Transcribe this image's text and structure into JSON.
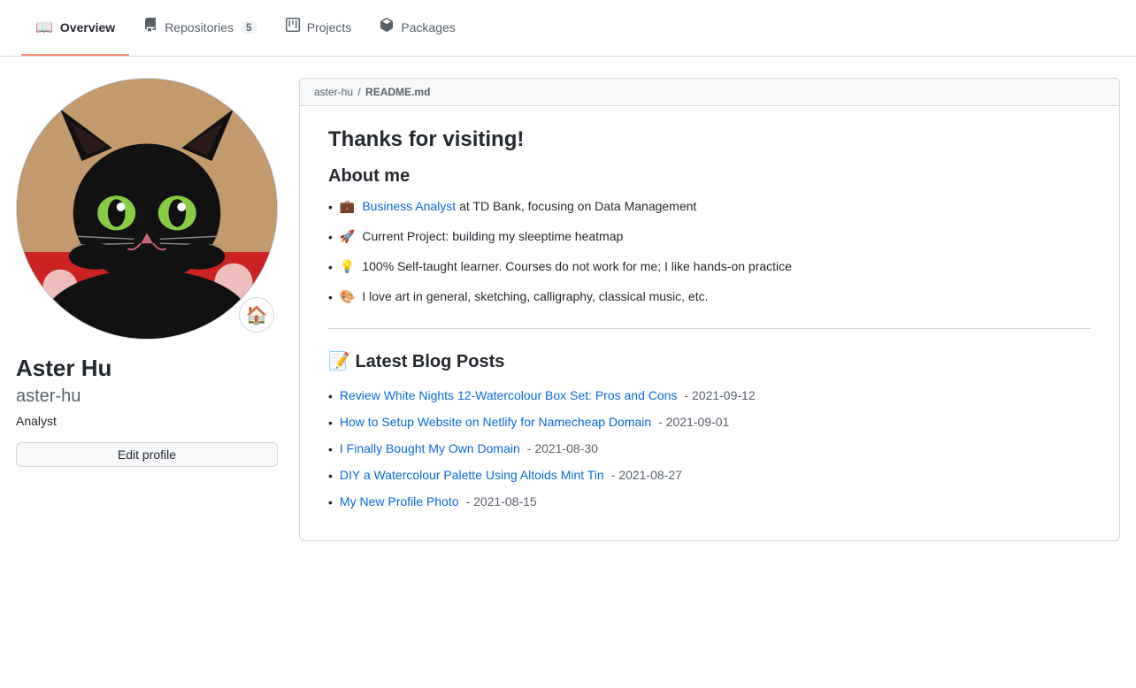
{
  "nav": {
    "tabs": [
      {
        "id": "overview",
        "label": "Overview",
        "icon": "📖",
        "active": true,
        "badge": null
      },
      {
        "id": "repositories",
        "label": "Repositories",
        "icon": "📂",
        "active": false,
        "badge": "5"
      },
      {
        "id": "projects",
        "label": "Projects",
        "icon": "📋",
        "active": false,
        "badge": null
      },
      {
        "id": "packages",
        "label": "Packages",
        "icon": "📦",
        "active": false,
        "badge": null
      }
    ]
  },
  "profile": {
    "display_name": "Aster Hu",
    "username": "aster-hu",
    "bio": "Analyst",
    "edit_button_label": "Edit profile",
    "avatar_badge_emoji": "🏠",
    "readme_path_user": "aster-hu",
    "readme_path_separator": "/",
    "readme_path_file": "README",
    "readme_path_ext": ".md"
  },
  "readme": {
    "heading": "Thanks for visiting!",
    "about_heading": "About me",
    "items": [
      {
        "emoji": "💼",
        "text_before": "",
        "link_text": "Business Analyst",
        "link_url": "#",
        "text_after": " at TD Bank, focusing on Data Management"
      },
      {
        "emoji": "🚀",
        "text_before": "",
        "link_text": null,
        "link_url": null,
        "text_after": "Current Project: building my sleeptime heatmap"
      },
      {
        "emoji": "💡",
        "text_before": "",
        "link_text": null,
        "link_url": null,
        "text_after": "100% Self-taught learner. Courses do not work for me; I like hands-on practice"
      },
      {
        "emoji": "🎨",
        "text_before": "",
        "link_text": null,
        "link_url": null,
        "text_after": "I love art in general, sketching, calligraphy, classical music, etc."
      }
    ]
  },
  "blog": {
    "heading": "📝 Latest Blog Posts",
    "posts": [
      {
        "title": "Review White Nights 12-Watercolour Box Set: Pros and Cons",
        "url": "#",
        "date": "2021-09-12"
      },
      {
        "title": "How to Setup Website on Netlify for Namecheap Domain",
        "url": "#",
        "date": "2021-09-01"
      },
      {
        "title": "I Finally Bought My Own Domain",
        "url": "#",
        "date": "2021-08-30"
      },
      {
        "title": "DIY a Watercolour Palette Using Altoids Mint Tin",
        "url": "#",
        "date": "2021-08-27"
      },
      {
        "title": "My New Profile Photo",
        "url": "#",
        "date": "2021-08-15"
      }
    ]
  }
}
